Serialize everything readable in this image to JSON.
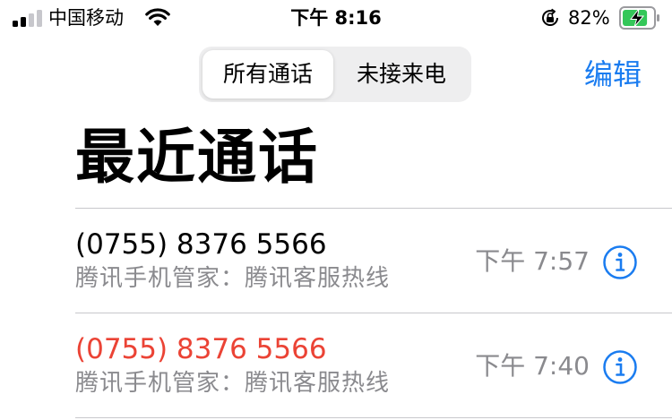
{
  "status_bar": {
    "carrier": "中国移动",
    "time": "下午 8:16",
    "battery_percent": "82%",
    "battery_level": 0.82,
    "icons": [
      "cellular-signal-icon",
      "wifi-icon",
      "orientation-lock-icon",
      "battery-charging-icon"
    ]
  },
  "header": {
    "tabs": [
      {
        "label": "所有通话",
        "selected": true
      },
      {
        "label": "未接来电",
        "selected": false
      }
    ],
    "edit_label": "编辑"
  },
  "title": "最近通话",
  "calls": [
    {
      "number": "(0755) 8376 5566",
      "label": "腾讯手机管家：腾讯客服热线",
      "time": "下午 7:57",
      "missed": false
    },
    {
      "number": "(0755) 8376 5566",
      "label": "腾讯手机管家：腾讯客服热线",
      "time": "下午 7:40",
      "missed": true
    }
  ],
  "colors": {
    "accent": "#1a7cf0",
    "missed": "#eb4335",
    "secondary_text": "#8a8a8e",
    "battery_charging": "#34c759"
  }
}
